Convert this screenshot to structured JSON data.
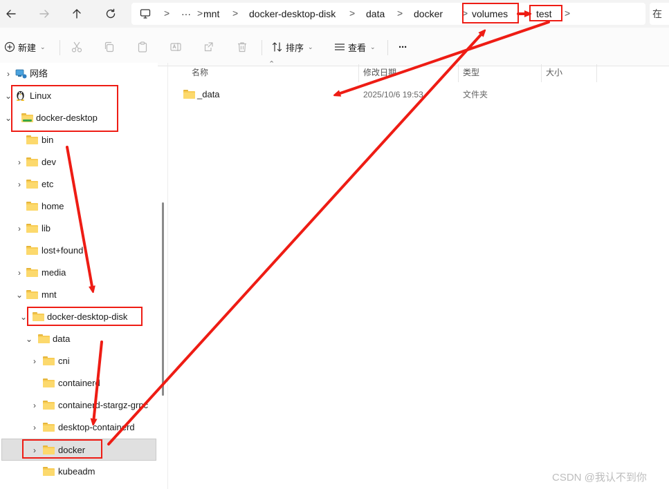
{
  "address_bar": {
    "back_icon": "arrow-left-icon",
    "forward_icon": "arrow-right-icon",
    "up_icon": "arrow-up-icon",
    "refresh_icon": "refresh-icon",
    "computer_icon": "monitor-icon",
    "overflow": "···",
    "separator": ">",
    "crumbs": [
      "mnt",
      "docker-desktop-disk",
      "data",
      "docker",
      "volumes",
      "test"
    ],
    "search_placeholder": "在"
  },
  "toolbar": {
    "new_label": "新建",
    "sort_label": "排序",
    "view_label": "查看",
    "more_label": "···",
    "icons": [
      "cut-icon",
      "copy-icon",
      "paste-icon",
      "rename-icon",
      "share-icon",
      "delete-icon"
    ]
  },
  "sidebar": {
    "items": [
      {
        "label": "网络",
        "chevron": "›",
        "icon": "network-icon"
      },
      {
        "label": "Linux",
        "chevron": "⌄",
        "icon": "linux-penguin-icon"
      },
      {
        "label": "docker-desktop",
        "chevron": "⌄",
        "icon": "folder-green-icon"
      },
      {
        "label": "bin",
        "chevron": "",
        "icon": "folder-icon"
      },
      {
        "label": "dev",
        "chevron": "›",
        "icon": "folder-icon"
      },
      {
        "label": "etc",
        "chevron": "›",
        "icon": "folder-icon"
      },
      {
        "label": "home",
        "chevron": "",
        "icon": "folder-icon"
      },
      {
        "label": "lib",
        "chevron": "›",
        "icon": "folder-icon"
      },
      {
        "label": "lost+found",
        "chevron": "",
        "icon": "folder-icon"
      },
      {
        "label": "media",
        "chevron": "›",
        "icon": "folder-icon"
      },
      {
        "label": "mnt",
        "chevron": "⌄",
        "icon": "folder-icon"
      },
      {
        "label": "docker-desktop-disk",
        "chevron": "⌄",
        "icon": "folder-icon"
      },
      {
        "label": "data",
        "chevron": "⌄",
        "icon": "folder-icon"
      },
      {
        "label": "cni",
        "chevron": "›",
        "icon": "folder-icon"
      },
      {
        "label": "containerd",
        "chevron": "",
        "icon": "folder-icon"
      },
      {
        "label": "containerd-stargz-grpc",
        "chevron": "›",
        "icon": "folder-icon"
      },
      {
        "label": "desktop-containerd",
        "chevron": "›",
        "icon": "folder-icon"
      },
      {
        "label": "docker",
        "chevron": "›",
        "icon": "folder-icon"
      },
      {
        "label": "kubeadm",
        "chevron": "",
        "icon": "folder-icon"
      }
    ]
  },
  "file_list": {
    "columns": [
      "名称",
      "修改日期",
      "类型",
      "大小"
    ],
    "rows": [
      {
        "name": "_data",
        "modified": "2025/10/6 19:53",
        "type": "文件夹",
        "size": ""
      }
    ]
  },
  "annotation": {
    "color": "#ee1c14"
  },
  "watermark": "CSDN @我认不到你"
}
